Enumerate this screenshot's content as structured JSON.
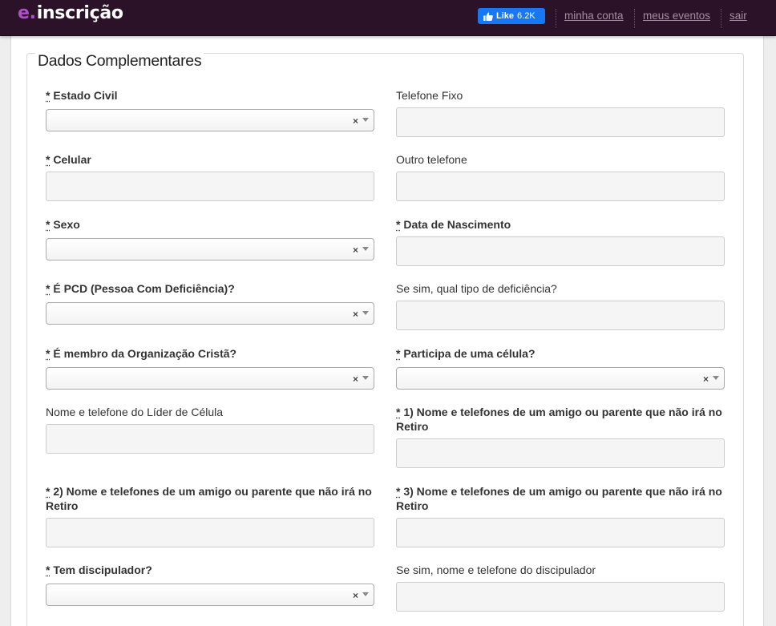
{
  "header": {
    "logo_e": "e",
    "logo_dot": ".",
    "logo_text": "inscrição",
    "fb_like_label": "Like",
    "fb_like_count": "6.2K",
    "nav": {
      "account": "minha conta",
      "events": "meus eventos",
      "logout": "sair"
    }
  },
  "form": {
    "legend": "Dados Complementares",
    "required_marker": "*",
    "fields": {
      "estado_civil": "Estado Civil",
      "telefone_fixo": "Telefone Fixo",
      "celular": "Celular",
      "outro_telefone": "Outro telefone",
      "sexo": "Sexo",
      "data_nascimento": "Data de Nascimento",
      "pcd": "É PCD (Pessoa Com Deficiência)?",
      "tipo_deficiencia": "Se sim, qual tipo de deficiência?",
      "membro_organizacao": "É membro da Organização Cristã?",
      "participa_celula": "Participa de uma célula?",
      "lider_celula": "Nome e telefone do Líder de Célula",
      "amigo_1": "1) Nome e telefones de um amigo ou parente que não irá no Retiro",
      "amigo_2": "2) Nome e telefones de um amigo ou parente que não irá no Retiro",
      "amigo_3": "3) Nome e telefones de um amigo ou parente que não irá no Retiro",
      "tem_discipulador": "Tem discipulador?",
      "discipulador_nome": "Se sim, nome e telefone do discipulador"
    },
    "select_clear_glyph": "×"
  }
}
